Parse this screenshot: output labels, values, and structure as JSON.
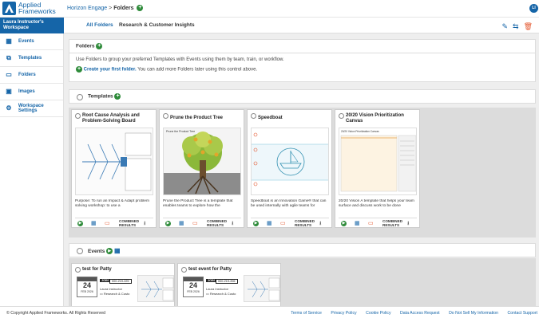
{
  "app": {
    "logo_line1": "Applied",
    "logo_line2": "Frameworks",
    "avatar_initials": "LI"
  },
  "breadcrumb": {
    "parent": "Horizon Engage",
    "separator": ">",
    "current": "Folders"
  },
  "sidebar": {
    "workspace": "Laura Instructor's Workspace",
    "items": [
      {
        "label": "Events",
        "icon": "calendar-icon"
      },
      {
        "label": "Templates",
        "icon": "templates-icon"
      },
      {
        "label": "Folders",
        "icon": "folder-icon"
      },
      {
        "label": "Images",
        "icon": "image-icon"
      },
      {
        "label": "Workspace Settings",
        "icon": "gear-icon"
      }
    ]
  },
  "tabs": [
    {
      "label": "All Folders"
    },
    {
      "label": "Research & Customer Insights"
    }
  ],
  "folders": {
    "title": "Folders",
    "description": "Use Folders to group your preferred Templates with Events using them by team, train, or workflow.",
    "create_link": "Create your first folder.",
    "create_suffix": " You can add more Folders later using this control above."
  },
  "templates": {
    "title": "Templates",
    "combined_label": "COMBINED RESULTS",
    "cards": [
      {
        "title": "Root Cause Analysis and Problem-Solving Board",
        "desc": "Purpose: To run an Impact & Adapt problem solving workshop: to use a"
      },
      {
        "title": "Prune the Product Tree",
        "desc": "Prune the Product Tree is a template that enables teams to explore how the",
        "thumb_label": "Prune the Product Tree"
      },
      {
        "title": "Speedboat",
        "desc": "Speedboat is an Innovation Game® that can be used internally with agile teams for"
      },
      {
        "title": "20/20 Vision Prioritization Canvas",
        "desc": "20/20 Vision A template that helps your team surface and discuss work to be done",
        "thumb_label": "20/20 Vision Prioritization Canvas"
      }
    ]
  },
  "events": {
    "title": "Events",
    "cards": [
      {
        "title": "test for Patty",
        "day": "24",
        "month": "FEB 2026",
        "join": "JOIN",
        "code": "000-219-225",
        "name": "Laura Instructor",
        "team": "Research & Custo"
      },
      {
        "title": "test event for Patty",
        "day": "24",
        "month": "FEB 2026",
        "join": "JOIN",
        "code": "000-219-206",
        "name": "Laura Instructor",
        "team": "Research & Custo"
      }
    ]
  },
  "footer": {
    "copyright": "© Copyright Applied Frameworks. All Rights Reserved",
    "links": [
      "Terms of Service",
      "Privacy Policy",
      "Cookie Policy",
      "Data Access Request",
      "Do Not Sell My Information",
      "Contact Support"
    ]
  },
  "colors": {
    "brand": "#1565a8",
    "add": "#2e8b3a",
    "accent": "#e4572e"
  }
}
